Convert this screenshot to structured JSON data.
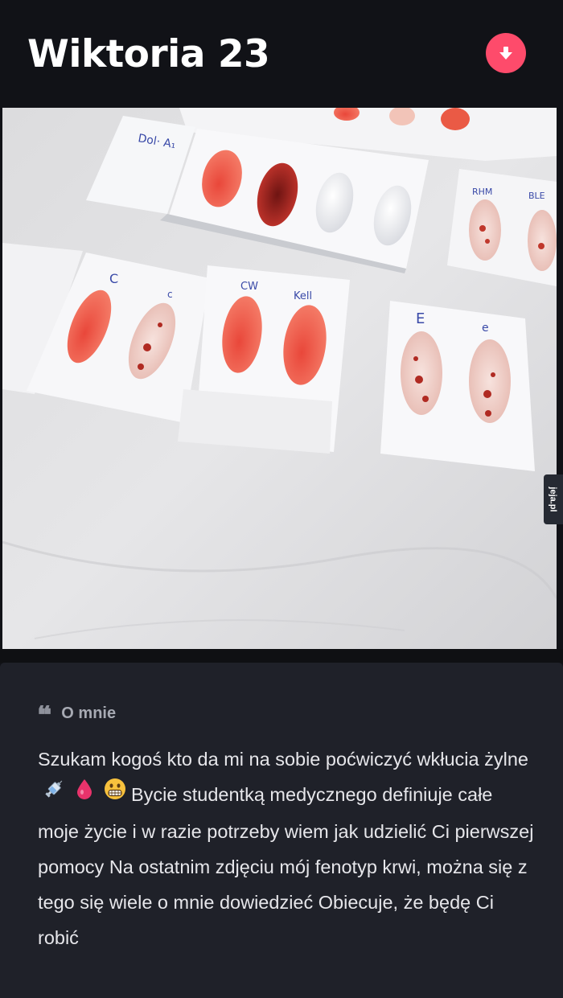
{
  "profile": {
    "name": "Wiktoria",
    "age": "23",
    "title": "Wiktoria 23"
  },
  "photo": {
    "plate_labels": {
      "anti_a1": "Dol· A₁",
      "rhm": "RHM",
      "ble": "BLE",
      "big_c": "C",
      "small_c": "c",
      "cw": "CW",
      "kell": "Kell",
      "big_e": "E",
      "small_e": "e"
    }
  },
  "watermark": "jeja.pl",
  "about": {
    "label": "O mnie",
    "bio_part1": "Szukam kogoś kto da mi na sobie poćwiczyć wkłucia żylne",
    "bio_part2": "Bycie studentką medycznego definiuje całe moje życie i w razie potrzeby wiem jak udzielić Ci pierwszej pomocy Na ostatnim zdjęciu mój fenotyp krwi, można się z tego się wiele o mnie dowiedzieć Obiecuje, że będę Ci robić"
  },
  "icons": {
    "collapse": "arrow-down-icon",
    "quote": "quote-icon",
    "syringe": "syringe-emoji",
    "drop": "blood-drop-emoji",
    "grin": "grimacing-face-emoji"
  },
  "colors": {
    "background": "#111217",
    "card": "#1f2129",
    "accent": "#fe4b6b",
    "text": "#e6e6ea",
    "label": "#a7aab3"
  }
}
